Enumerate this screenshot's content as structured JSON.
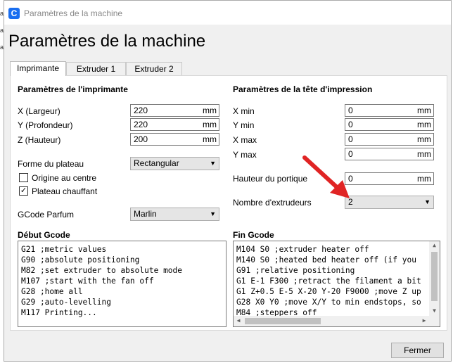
{
  "window": {
    "title": "Paramètres de la machine",
    "app_icon_letter": "C",
    "heading": "Paramètres de la machine"
  },
  "tabs": [
    "Imprimante",
    "Extruder 1",
    "Extruder 2"
  ],
  "printer": {
    "section_title": "Paramètres de l'imprimante",
    "x_label": "X (Largeur)",
    "x_value": "220",
    "x_unit": "mm",
    "y_label": "Y (Profondeur)",
    "y_value": "220",
    "y_unit": "mm",
    "z_label": "Z (Hauteur)",
    "z_value": "200",
    "z_unit": "mm",
    "bed_shape_label": "Forme du plateau",
    "bed_shape_value": "Rectangular",
    "origin_center_label": "Origine au centre",
    "origin_center_checked": false,
    "heated_bed_label": "Plateau chauffant",
    "heated_bed_checked": true,
    "gcode_flavor_label": "GCode Parfum",
    "gcode_flavor_value": "Marlin"
  },
  "head": {
    "section_title": "Paramètres de la tête d'impression",
    "xmin_label": "X min",
    "xmin_value": "0",
    "xmin_unit": "mm",
    "ymin_label": "Y min",
    "ymin_value": "0",
    "ymin_unit": "mm",
    "xmax_label": "X max",
    "xmax_value": "0",
    "xmax_unit": "mm",
    "ymax_label": "Y max",
    "ymax_value": "0",
    "ymax_unit": "mm",
    "gantry_label": "Hauteur du portique",
    "gantry_value": "0",
    "gantry_unit": "mm",
    "extruders_label": "Nombre d'extrudeurs",
    "extruders_value": "2"
  },
  "start_gcode": {
    "title": "Début Gcode",
    "lines": [
      "G21 ;metric values",
      "G90 ;absolute positioning",
      "M82 ;set extruder to absolute mode",
      "M107 ;start with the fan off",
      "G28 ;home all",
      "G29 ;auto-levelling",
      "M117 Printing..."
    ]
  },
  "end_gcode": {
    "title": "Fin Gcode",
    "lines": [
      "M104 S0 ;extruder heater off",
      "M140 S0 ;heated bed heater off (if you",
      "G91 ;relative positioning",
      "G1 E-1 F300 ;retract the filament a bit",
      "G1 Z+0.5 E-5 X-20 Y-20 F9000 ;move Z up",
      "G28 X0 Y0 ;move X/Y to min endstops, so",
      "M84 ;steppers off"
    ]
  },
  "close_button": "Fermer",
  "colors": {
    "accent": "#196ef0",
    "arrow": "#e02424"
  },
  "icons": {
    "dropdown": "chevron-down-icon",
    "check": "checkmark-icon"
  }
}
